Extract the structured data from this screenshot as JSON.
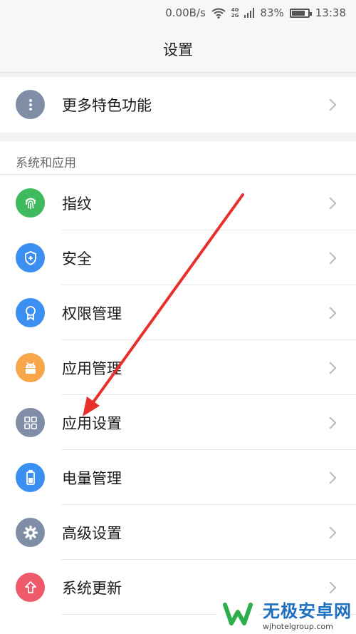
{
  "status_bar": {
    "speed": "0.00B/s",
    "net_top": "4G",
    "net_bottom": "2G",
    "battery": "83%",
    "battery_level": 0.83,
    "time": "13:38"
  },
  "title": "设置",
  "top_item": {
    "label": "更多特色功能",
    "icon": "more-dots-icon",
    "color": "#7f8ea6"
  },
  "section": {
    "title": "系统和应用"
  },
  "items": [
    {
      "label": "指纹",
      "icon": "fingerprint-icon",
      "color": "#3fba5e"
    },
    {
      "label": "安全",
      "icon": "shield-icon",
      "color": "#3a8ff0"
    },
    {
      "label": "权限管理",
      "icon": "permission-badge-icon",
      "color": "#3a8ff0"
    },
    {
      "label": "应用管理",
      "icon": "android-robot-icon",
      "color": "#f7a64a"
    },
    {
      "label": "应用设置",
      "icon": "grid-apps-icon",
      "color": "#7f8ea6"
    },
    {
      "label": "电量管理",
      "icon": "battery-icon",
      "color": "#3a8ff0"
    },
    {
      "label": "高级设置",
      "icon": "gear-icon",
      "color": "#7f8ea6"
    },
    {
      "label": "系统更新",
      "icon": "upload-arrow-icon",
      "color": "#ef5a6b"
    }
  ],
  "watermark": {
    "name": "无极安卓网",
    "url": "wjhotelgroup.com"
  }
}
